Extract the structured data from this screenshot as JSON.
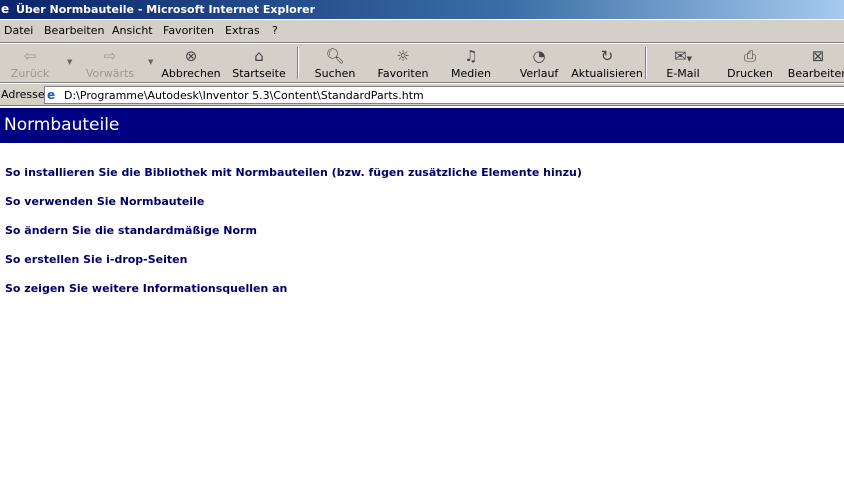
{
  "window": {
    "title": "Über Normbauteile - Microsoft Internet Explorer"
  },
  "menu": [
    "Datei",
    "Bearbeiten",
    "Ansicht",
    "Favoriten",
    "Extras",
    "?"
  ],
  "toolbar": {
    "back": "Zurück",
    "forward": "Vorwärts",
    "stop": "Abbrechen",
    "home": "Startseite",
    "search": "Suchen",
    "favorites": "Favoriten",
    "media": "Medien",
    "history": "Verlauf",
    "refresh": "Aktualisieren",
    "mail": "E-Mail",
    "print": "Drucken",
    "edit": "Bearbeiten"
  },
  "address": {
    "label": "Adresse",
    "url": "D:\\Programme\\Autodesk\\Inventor 5.3\\Content\\StandardParts.htm"
  },
  "page": {
    "heading": "Normbauteile",
    "links": [
      "So installieren Sie die Bibliothek mit Normbauteilen (bzw. fügen zusätzliche Elemente hinzu)",
      "So verwenden Sie Normbauteile",
      "So ändern Sie die standardmäßige Norm",
      "So erstellen Sie i-drop-Seiten",
      "So zeigen Sie weitere Informationsquellen an"
    ]
  }
}
